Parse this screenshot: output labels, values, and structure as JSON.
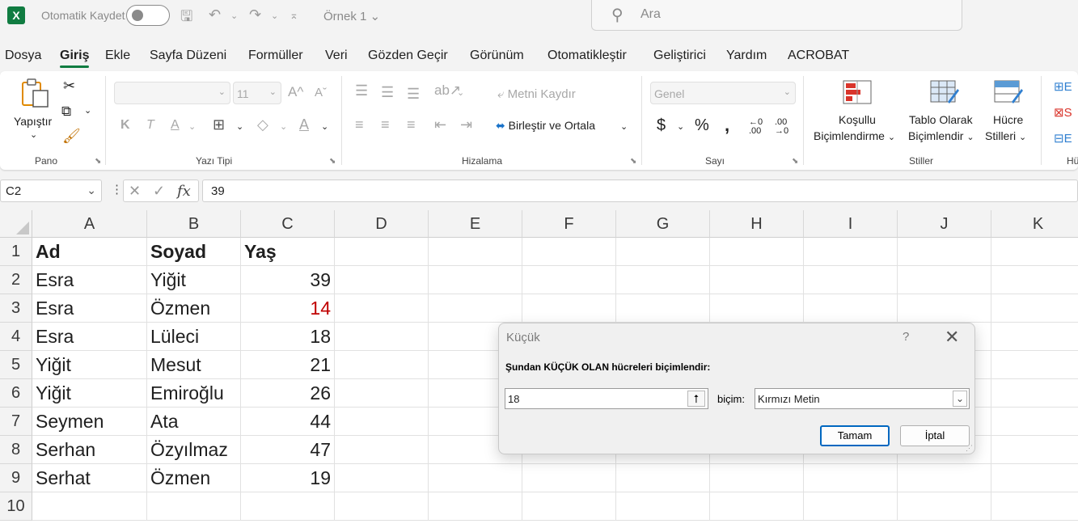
{
  "titlebar": {
    "autosave_label": "Otomatik Kaydet",
    "doc_name": "Örnek 1",
    "search_placeholder": "Ara"
  },
  "menu": [
    "Dosya",
    "Giriş",
    "Ekle",
    "Sayfa Düzeni",
    "Formüller",
    "Veri",
    "Gözden Geçir",
    "Görünüm",
    "Otomatikleştir",
    "Geliştirici",
    "Yardım",
    "ACROBAT"
  ],
  "ribbon": {
    "paste_label": "Yapıştır",
    "font_size": "11",
    "bold": "K",
    "italic": "T",
    "wrap_text": "Metni Kaydır",
    "merge_center": "Birleştir ve Ortala",
    "number_format": "Genel",
    "cond_format_line1": "Koşullu",
    "cond_format_line2": "Biçimlendirme",
    "table_format_line1": "Tablo Olarak",
    "table_format_line2": "Biçimlendir",
    "cell_styles_line1": "Hücre",
    "cell_styles_line2": "Stilleri",
    "groups": [
      "Pano",
      "Yazı Tipi",
      "Hizalama",
      "Sayı",
      "Stiller",
      "Hü"
    ]
  },
  "formula_bar": {
    "name_box": "C2",
    "formula": "39"
  },
  "sheet": {
    "columns": [
      "A",
      "B",
      "C",
      "D",
      "E",
      "F",
      "G",
      "H",
      "I",
      "J",
      "K"
    ],
    "rows": [
      "1",
      "2",
      "3",
      "4",
      "5",
      "6",
      "7",
      "8",
      "9",
      "10"
    ],
    "headers": [
      "Ad",
      "Soyad",
      "Yaş"
    ],
    "data": [
      [
        "Esra",
        "Yiğit",
        "39"
      ],
      [
        "Esra",
        "Özmen",
        "14"
      ],
      [
        "Esra",
        "Lüleci",
        "18"
      ],
      [
        "Yiğit",
        "Mesut",
        "21"
      ],
      [
        "Yiğit",
        "Emiroğlu",
        "26"
      ],
      [
        "Seymen",
        "Ata",
        "44"
      ],
      [
        "Serhan",
        "Özyılmaz",
        "47"
      ],
      [
        "Serhat",
        "Özmen",
        "19"
      ]
    ],
    "highlight_color": "#c00000"
  },
  "dialog": {
    "title": "Küçük",
    "help": "?",
    "prompt": "Şundan KÜÇÜK OLAN hücreleri biçimlendir:",
    "value": "18",
    "format_label": "biçim:",
    "format_value": "Kırmızı Metin",
    "ok_label": "Tamam",
    "cancel_label": "İptal"
  },
  "colors": {
    "accent": "#107c41",
    "focus": "#0067c0"
  }
}
